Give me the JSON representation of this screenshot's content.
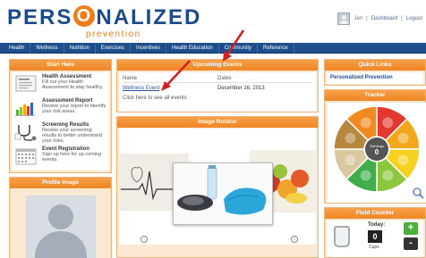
{
  "brand": {
    "main_before": "PERS",
    "main_o": "O",
    "main_after": "NALIZED",
    "sub": "prevention",
    "colors": {
      "blue": "#1b4a8a",
      "orange": "#f07d1c"
    }
  },
  "user": {
    "name": "Jen",
    "sep": "|",
    "dashboard_label": "Dashboard",
    "logout_label": "Logout"
  },
  "nav": {
    "items": [
      "Health",
      "Wellness",
      "Nutrition",
      "Exercises",
      "Incentives",
      "Health Education",
      "Community",
      "Reference"
    ]
  },
  "start_here": {
    "title": "Start Here",
    "items": [
      {
        "title": "Health Assessment",
        "desc": "Fill out your Health Assessment to stay healthy.",
        "icon": "document-icon"
      },
      {
        "title": "Assessment Report",
        "desc": "Review your report to identify your risk areas.",
        "icon": "bar-chart-icon"
      },
      {
        "title": "Screening Results",
        "desc": "Review your screening results to better understand your risks.",
        "icon": "stethoscope-icon"
      },
      {
        "title": "Event Registration",
        "desc": "Sign up here for up coming events.",
        "icon": "calendar-icon"
      }
    ]
  },
  "profile": {
    "title": "Profile Image"
  },
  "events": {
    "title": "Upcoming Events",
    "col_name": "Name",
    "col_date": "Dates",
    "rows": [
      {
        "name": "Wellness Event",
        "date": "December 16, 2013"
      }
    ],
    "more": "Click here to see all events"
  },
  "rotator": {
    "title": "Image Rotator"
  },
  "quick_links": {
    "title": "Quick Links",
    "items": [
      "Personalized Prevention"
    ]
  },
  "tracker": {
    "title": "Tracker",
    "center_label": "Servings",
    "center_count": "0",
    "segments": [
      "#e3382f",
      "#f3a81c",
      "#f6d21f",
      "#8cc63f",
      "#3fae4a",
      "#d9c8a0",
      "#b5883e",
      "#f28a21"
    ]
  },
  "fluid": {
    "title": "Fluid Counter",
    "today_label": "Today:",
    "count": "0",
    "unit": "Cups",
    "plus": "+",
    "minus": "-"
  }
}
